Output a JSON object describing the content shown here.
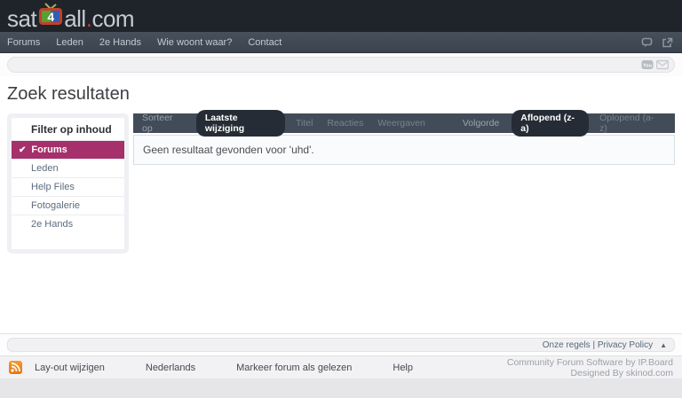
{
  "header": {
    "logo_pre": "sat",
    "logo_tv_char": "4",
    "logo_mid": "all",
    "logo_dot": ".",
    "logo_suffix": "com"
  },
  "nav": {
    "items": [
      {
        "label": "Forums"
      },
      {
        "label": "Leden"
      },
      {
        "label": "2e Hands"
      },
      {
        "label": "Wie woont waar?"
      },
      {
        "label": "Contact"
      }
    ],
    "icons": [
      "chat-icon",
      "external-link-icon"
    ]
  },
  "search_bar": {
    "icons": [
      "youtube-icon",
      "mail-icon"
    ]
  },
  "page": {
    "title": "Zoek resultaten"
  },
  "sidebar": {
    "title": "Filter op inhoud",
    "check_glyph": "✔",
    "items": [
      {
        "label": "Forums",
        "active": true
      },
      {
        "label": "Leden",
        "active": false
      },
      {
        "label": "Help Files",
        "active": false
      },
      {
        "label": "Fotogalerie",
        "active": false
      },
      {
        "label": "2e Hands",
        "active": false
      }
    ]
  },
  "sortbar": {
    "sort_label": "Sorteer op",
    "sort_options": [
      {
        "label": "Laatste wijziging",
        "active": true
      },
      {
        "label": "Titel",
        "active": false
      },
      {
        "label": "Reacties",
        "active": false
      },
      {
        "label": "Weergaven",
        "active": false
      }
    ],
    "order_label": "Volgorde",
    "order_options": [
      {
        "label": "Aflopend (z-a)",
        "active": true
      },
      {
        "label": "Oplopend (a-z)",
        "active": false
      }
    ]
  },
  "results": {
    "empty_message": "Geen resultaat gevonden voor 'uhd'."
  },
  "bottom_bar": {
    "links_label": "Onze regels | Privacy Policy",
    "back_to_top_glyph": "▲"
  },
  "footer": {
    "links": [
      {
        "label": "Lay-out wijzigen"
      },
      {
        "label": "Nederlands"
      },
      {
        "label": "Markeer forum als gelezen"
      },
      {
        "label": "Help"
      }
    ],
    "credits_line1": "Community Forum Software by IP.Board",
    "credits_line2": "Designed By skinod.com"
  },
  "colors": {
    "header_bg": "#1f242a",
    "nav_bg": "#3a434e",
    "accent_active_filter": "#a5306b",
    "sortbar_bg": "#424c58",
    "sort_pill_bg": "#252c35",
    "rss_orange": "#e8740f",
    "logo_dot_red": "#bb4034"
  }
}
